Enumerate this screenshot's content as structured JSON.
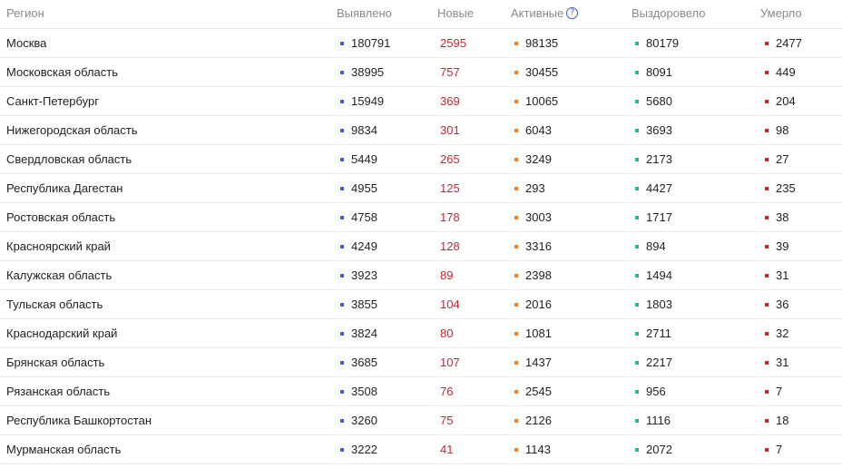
{
  "colors": {
    "found_dot": "#3d63c9",
    "new_text": "#d0232a",
    "active_dot": "#ef7d32",
    "recovered_dot": "#1fb8a5",
    "died_dot": "#d0232a"
  },
  "header": {
    "region": "Регион",
    "found": "Выявлено",
    "new": "Новые",
    "active": "Активные",
    "active_help_icon": "?",
    "recovered": "Выздоровело",
    "died": "Умерло"
  },
  "rows": [
    {
      "region": "Москва",
      "found": "180791",
      "new": "2595",
      "active": "98135",
      "recovered": "80179",
      "died": "2477"
    },
    {
      "region": "Московская область",
      "found": "38995",
      "new": "757",
      "active": "30455",
      "recovered": "8091",
      "died": "449"
    },
    {
      "region": "Санкт-Петербург",
      "found": "15949",
      "new": "369",
      "active": "10065",
      "recovered": "5680",
      "died": "204"
    },
    {
      "region": "Нижегородская область",
      "found": "9834",
      "new": "301",
      "active": "6043",
      "recovered": "3693",
      "died": "98"
    },
    {
      "region": "Свердловская область",
      "found": "5449",
      "new": "265",
      "active": "3249",
      "recovered": "2173",
      "died": "27"
    },
    {
      "region": "Республика Дагестан",
      "found": "4955",
      "new": "125",
      "active": "293",
      "recovered": "4427",
      "died": "235"
    },
    {
      "region": "Ростовская область",
      "found": "4758",
      "new": "178",
      "active": "3003",
      "recovered": "1717",
      "died": "38"
    },
    {
      "region": "Красноярский край",
      "found": "4249",
      "new": "128",
      "active": "3316",
      "recovered": "894",
      "died": "39"
    },
    {
      "region": "Калужская область",
      "found": "3923",
      "new": "89",
      "active": "2398",
      "recovered": "1494",
      "died": "31"
    },
    {
      "region": "Тульская область",
      "found": "3855",
      "new": "104",
      "active": "2016",
      "recovered": "1803",
      "died": "36"
    },
    {
      "region": "Краснодарский край",
      "found": "3824",
      "new": "80",
      "active": "1081",
      "recovered": "2711",
      "died": "32"
    },
    {
      "region": "Брянская область",
      "found": "3685",
      "new": "107",
      "active": "1437",
      "recovered": "2217",
      "died": "31"
    },
    {
      "region": "Рязанская область",
      "found": "3508",
      "new": "76",
      "active": "2545",
      "recovered": "956",
      "died": "7"
    },
    {
      "region": "Республика Башкортостан",
      "found": "3260",
      "new": "75",
      "active": "2126",
      "recovered": "1116",
      "died": "18"
    },
    {
      "region": "Мурманская область",
      "found": "3222",
      "new": "41",
      "active": "1143",
      "recovered": "2072",
      "died": "7"
    }
  ]
}
